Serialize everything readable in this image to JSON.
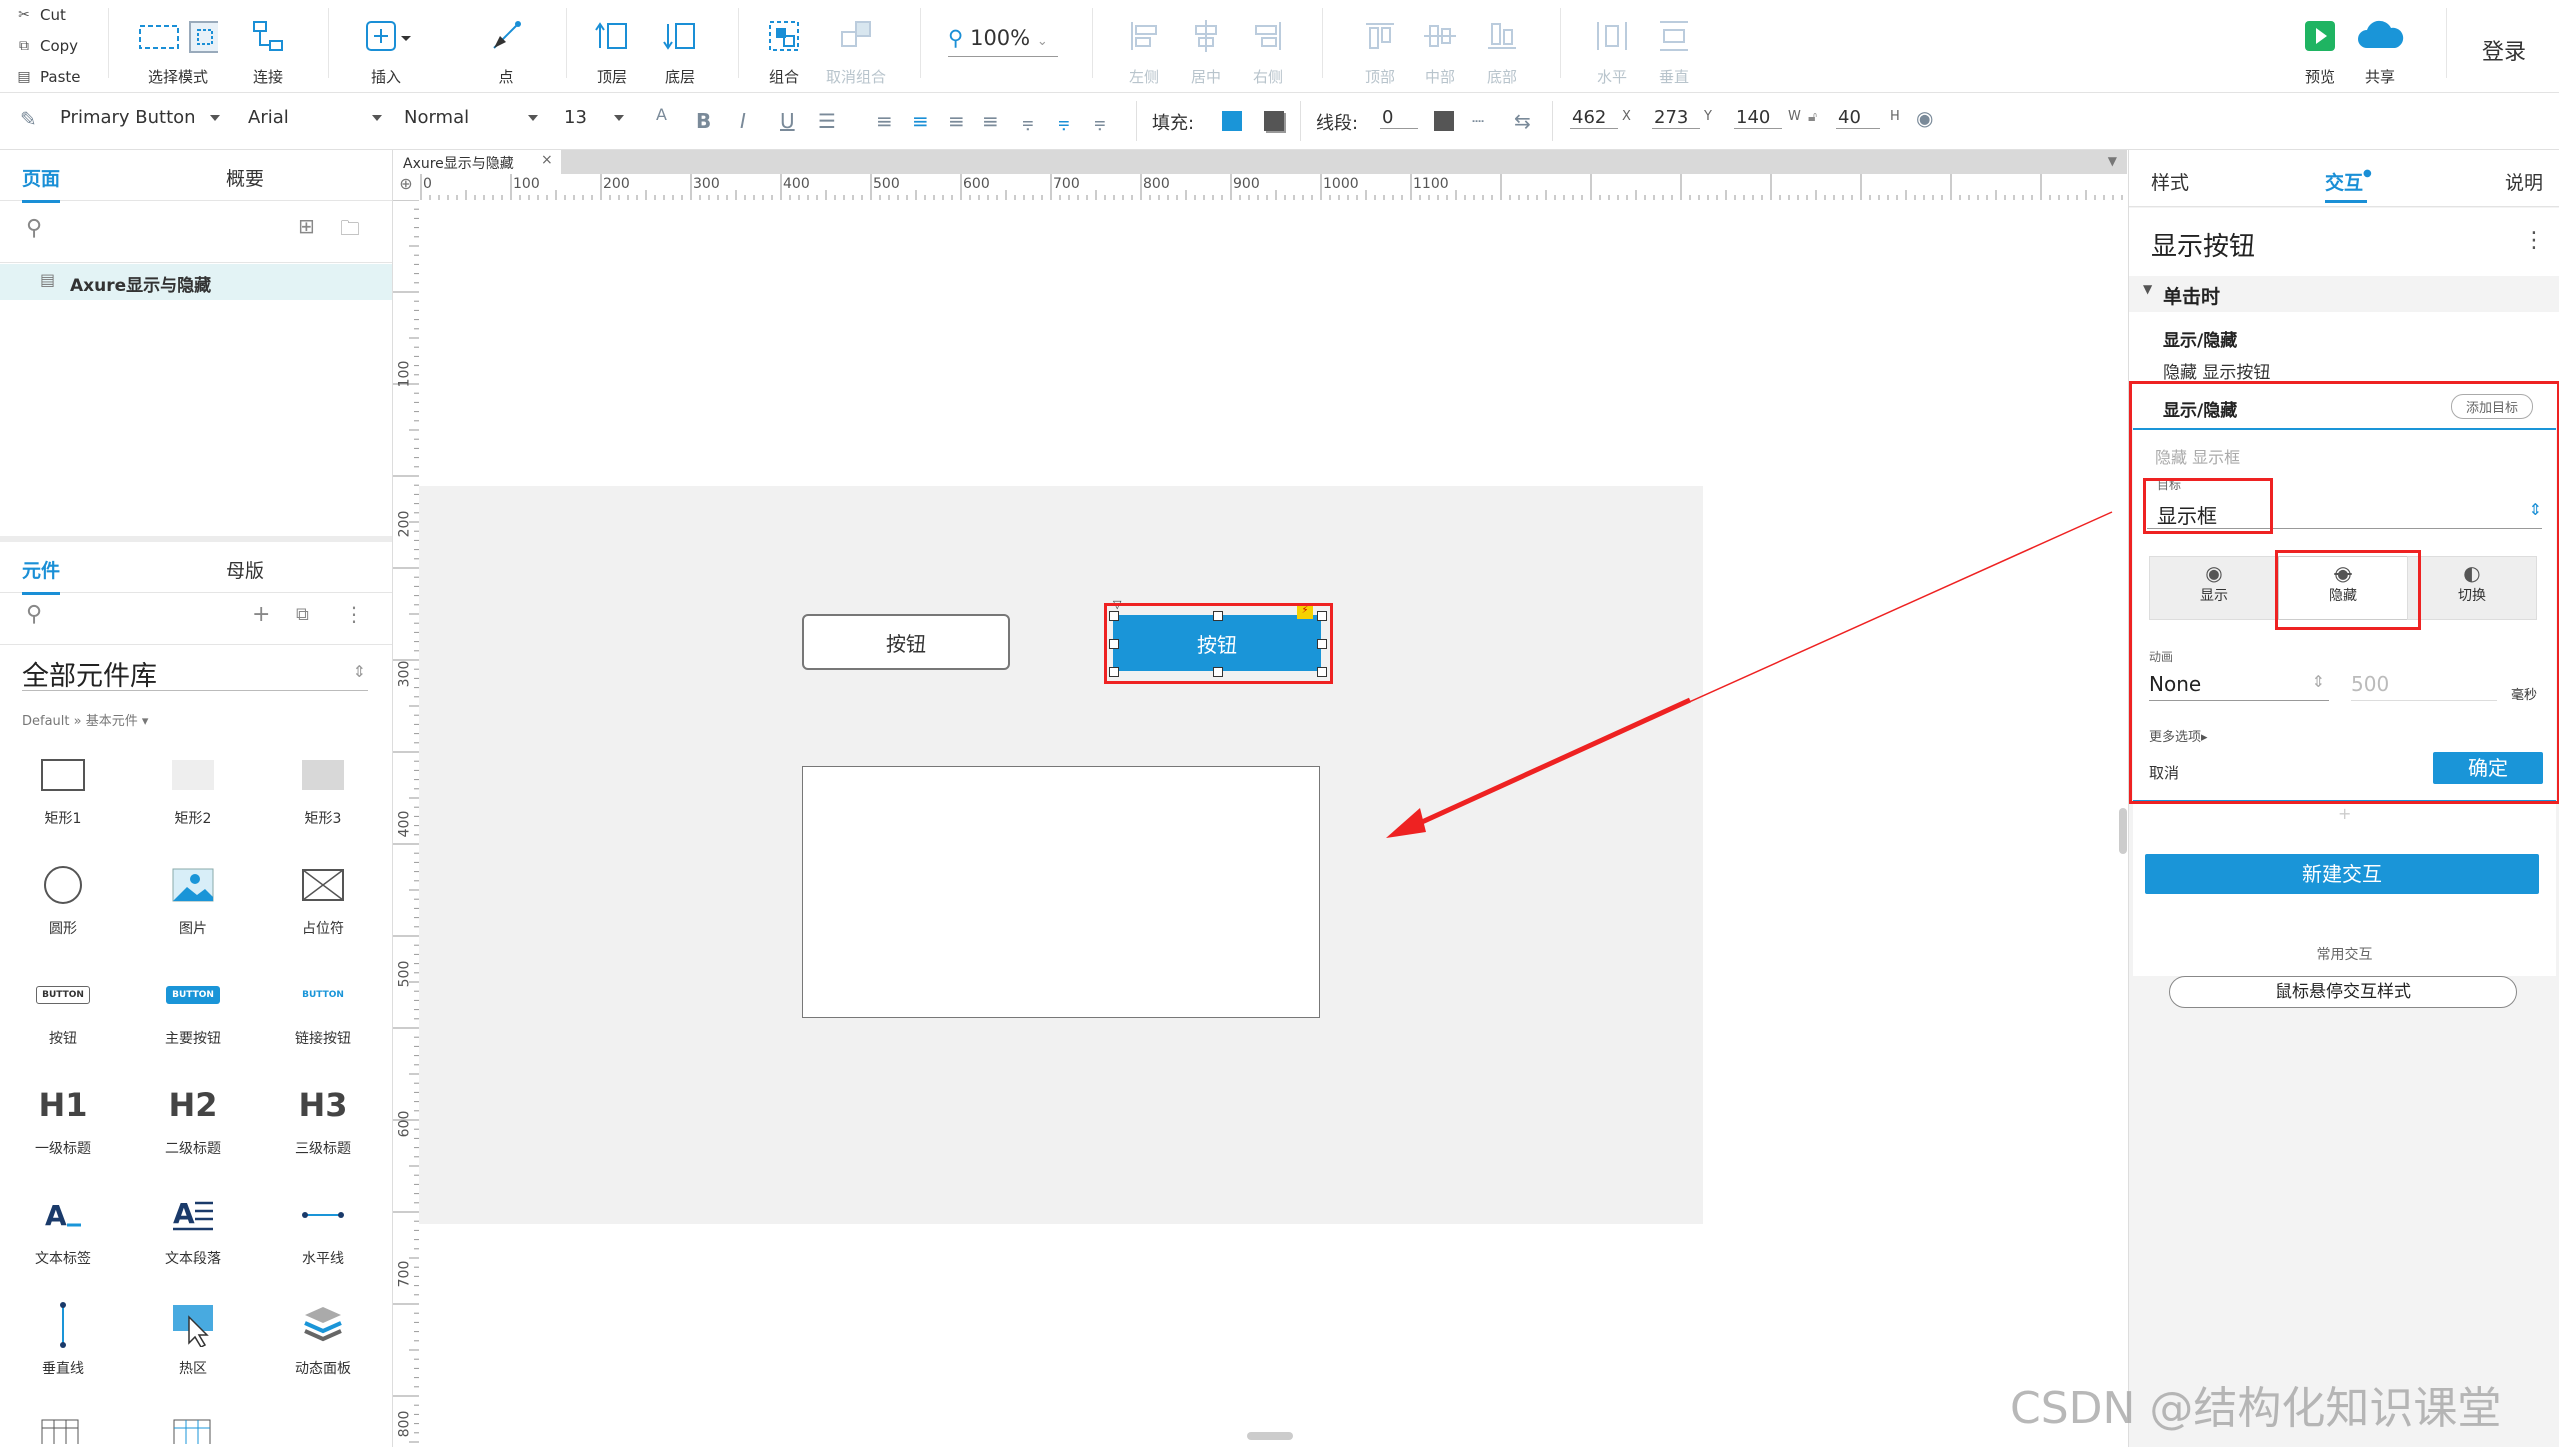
{
  "clipboard": {
    "cut": "Cut",
    "copy": "Copy",
    "paste": "Paste"
  },
  "toolbar": {
    "select_mode": "选择模式",
    "connect": "连接",
    "insert": "插入",
    "point": "点",
    "top_layer": "顶层",
    "bottom_layer": "底层",
    "group": "组合",
    "ungroup": "取消组合",
    "zoom": "100%",
    "align_left": "左侧",
    "align_center": "居中",
    "align_right": "右侧",
    "align_top": "顶部",
    "align_middle": "中部",
    "align_bottom": "底部",
    "distribute_h": "水平",
    "distribute_v": "垂直",
    "preview": "预览",
    "share": "共享",
    "login": "登录"
  },
  "format_bar": {
    "style_name": "Primary Button",
    "font_family": "Arial",
    "font_weight": "Normal",
    "font_size": "13",
    "bold": "B",
    "italic": "I",
    "underline": "U",
    "fill_label": "填充:",
    "line_label": "线段:",
    "line_value": "0",
    "x": "462",
    "x_label": "X",
    "y": "273",
    "y_label": "Y",
    "w": "140",
    "w_label": "W",
    "h": "40",
    "h_label": "H"
  },
  "left_panel": {
    "tab_pages": "页面",
    "tab_outline": "概要",
    "page_item": "Axure显示与隐藏",
    "tab_components": "元件",
    "tab_masters": "母版",
    "library": "全部元件库",
    "library_path": "Default » 基本元件 ▾",
    "components": [
      {
        "label": "矩形1"
      },
      {
        "label": "矩形2"
      },
      {
        "label": "矩形3"
      },
      {
        "label": "圆形"
      },
      {
        "label": "图片"
      },
      {
        "label": "占位符"
      },
      {
        "label": "按钮",
        "preview": "BUTTON"
      },
      {
        "label": "主要按钮",
        "preview": "BUTTON"
      },
      {
        "label": "链接按钮",
        "preview": "BUTTON"
      },
      {
        "label": "一级标题",
        "preview": "H1"
      },
      {
        "label": "二级标题",
        "preview": "H2"
      },
      {
        "label": "三级标题",
        "preview": "H3"
      },
      {
        "label": "文本标签"
      },
      {
        "label": "文本段落"
      },
      {
        "label": "水平线"
      },
      {
        "label": "垂直线"
      },
      {
        "label": "热区"
      },
      {
        "label": "动态面板"
      }
    ]
  },
  "canvas": {
    "doc_tab": "Axure显示与隐藏",
    "ruler_h": [
      "0",
      "100",
      "200",
      "300",
      "400",
      "500",
      "600",
      "700",
      "800",
      "900",
      "1000",
      "1100"
    ],
    "ruler_v": [
      "100",
      "200",
      "300",
      "400",
      "500",
      "600",
      "700",
      "800"
    ],
    "button_secondary": "按钮",
    "button_primary": "按钮"
  },
  "right_panel": {
    "tab_style": "样式",
    "tab_interaction": "交互",
    "tab_notes": "说明",
    "widget_name": "显示按钮",
    "event": "单击时",
    "action1_title": "显示/隐藏",
    "action1_desc": "隐藏 显示按钮",
    "action2_title": "显示/隐藏",
    "add_target": "添加目标",
    "action2_desc": "隐藏 显示框",
    "target_label": "目标",
    "target_value": "显示框",
    "opt_show": "显示",
    "opt_hide": "隐藏",
    "opt_toggle": "切换",
    "anim_label": "动画",
    "anim_value": "None",
    "anim_ms": "500",
    "anim_unit": "毫秒",
    "more_options": "更多选项▸",
    "cancel": "取消",
    "confirm": "确定",
    "new_interaction": "新建交互",
    "common_interactions": "常用交互",
    "hover_style": "鼠标悬停交互样式"
  },
  "watermark": "CSDN @结构化知识课堂",
  "colors": {
    "accent": "#1a95d8",
    "highlight": "#ee2222"
  }
}
